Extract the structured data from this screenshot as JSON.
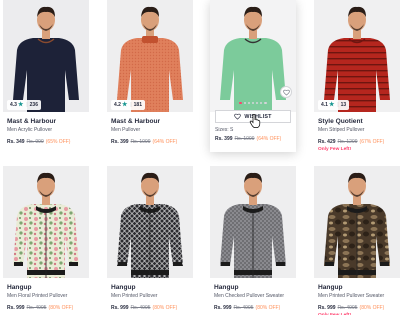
{
  "products": [
    {
      "brand": "Mast & Harbour",
      "description": "Men Acrylic Pullover",
      "price": "Rs. 349",
      "mrp": "Rs. 999",
      "discount": "(65% OFF)",
      "rating": "4.3",
      "rating_count": "236",
      "sweater_color": "#1d2238",
      "skin": "#d9a07b",
      "hair": "#2a1d17",
      "bg": "#ececee",
      "pattern": "plain",
      "accent": "#8a4b2f"
    },
    {
      "brand": "Mast & Harbour",
      "description": "Men Pullover",
      "price": "Rs. 399",
      "mrp": "Rs. 1099",
      "discount": "(64% OFF)",
      "rating": "4.2",
      "rating_count": "181",
      "sweater_color": "#e0805c",
      "skin": "#d9a07b",
      "hair": "#2a1d17",
      "bg": "#eeeeef",
      "pattern": "knit",
      "accent": "#c2512f"
    },
    {
      "brand": "",
      "description": "",
      "price": "Rs. 399",
      "mrp": "Rs. 1099",
      "discount": "(64% OFF)",
      "sizes": "Sizes: S",
      "wishlist_label": "WISHLIST",
      "sweater_color": "#7ccb9b",
      "skin": "#d9a07b",
      "hair": "#2a1d17",
      "bg": "#f3f3f4",
      "pattern": "plain",
      "hovered": true
    },
    {
      "brand": "Style Quotient",
      "description": "Men Striped Pullover",
      "price": "Rs. 429",
      "mrp": "Rs. 1299",
      "discount": "(67% OFF)",
      "stock_note": "Only Few Left!",
      "rating": "4.1",
      "rating_count": "13",
      "sweater_color": "#b5261e",
      "skin": "#d9a07b",
      "hair": "#2a1d17",
      "bg": "#f0f0f1",
      "pattern": "stripes",
      "accent": "#6e1510"
    },
    {
      "brand": "Hangup",
      "description": "Men Floral Printed Pullover",
      "price": "Rs. 999",
      "mrp": "Rs. 4995",
      "discount": "(80% OFF)",
      "sweater_color": "#e9ecd6",
      "skin": "#d9a07b",
      "hair": "#2a1d17",
      "bg": "#eeeeef",
      "pattern": "floral",
      "accent": "#e79aa3"
    },
    {
      "brand": "Hangup",
      "description": "Men Printed Pullover",
      "price": "Rs. 999",
      "mrp": "Rs. 4995",
      "discount": "(80% OFF)",
      "sweater_color": "#2c2c30",
      "skin": "#d9a07b",
      "hair": "#2a1d17",
      "bg": "#eeeeef",
      "pattern": "geo",
      "accent": "#e8e8e8"
    },
    {
      "brand": "Hangup",
      "description": "Men Checked Pullover Sweater",
      "price": "Rs. 999",
      "mrp": "Rs. 4995",
      "discount": "(80% OFF)",
      "sweater_color": "#6f6f73",
      "skin": "#d9a07b",
      "hair": "#2a1d17",
      "bg": "#eeeeef",
      "pattern": "check",
      "accent": "#8a8a8f"
    },
    {
      "brand": "Hangup",
      "description": "Men Printed Pullover Sweater",
      "price": "Rs. 999",
      "mrp": "Rs. 4995",
      "discount": "(80% OFF)",
      "stock_note": "Only Few Left!",
      "sweater_color": "#4a3a2a",
      "skin": "#d9a07b",
      "hair": "#2a1d17",
      "bg": "#eeeeef",
      "pattern": "camo",
      "accent": "#8c7455"
    }
  ],
  "theme": {
    "star_color": "#14958f",
    "discount_color": "#ff905a",
    "alert_color": "#ff3e6c"
  }
}
